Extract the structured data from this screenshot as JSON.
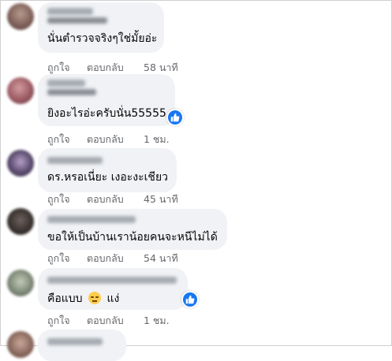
{
  "colors": {
    "bubble_bg": "#f0f2f5",
    "action_text": "#65676b",
    "like_blue": "#1877f2"
  },
  "comments": [
    {
      "text": "นั่นตำรวจจริงๆใช่มั้ยอ่ะ",
      "like_label": "ถูกใจ",
      "reply_label": "ตอบกลับ",
      "time": "58 นาที",
      "has_like_badge": false,
      "avatar_color": "#8a6f6a"
    },
    {
      "text": "ยิงอะไรอ่ะครับนั่น55555",
      "like_label": "ถูกใจ",
      "reply_label": "ตอบกลับ",
      "time": "1 ชม.",
      "has_like_badge": true,
      "avatar_color": "#9b5a62"
    },
    {
      "text": "ดร.หรอเนี่ยะ เงอะงะเชียว",
      "like_label": "ถูกใจ",
      "reply_label": "ตอบกลับ",
      "time": "45 นาที",
      "has_like_badge": false,
      "avatar_color": "#5a4b6e"
    },
    {
      "text": "ขอให้เป็นบ้านเราน้อยคนจะหนีไม่ได้",
      "like_label": "ถูกใจ",
      "reply_label": "ตอบกลับ",
      "time": "54 นาที",
      "has_like_badge": false,
      "avatar_color": "#3a3330"
    },
    {
      "text_before_emoji": "คือแบบ",
      "emoji": "unamused-face-emoji",
      "text_after_emoji": "แง่",
      "like_label": "ถูกใจ",
      "reply_label": "ตอบกลับ",
      "time": "1 ชม.",
      "has_like_badge": true,
      "avatar_color": "#7f8a78"
    }
  ],
  "partial_comment": {
    "avatar_color": "#8b6a5e"
  }
}
